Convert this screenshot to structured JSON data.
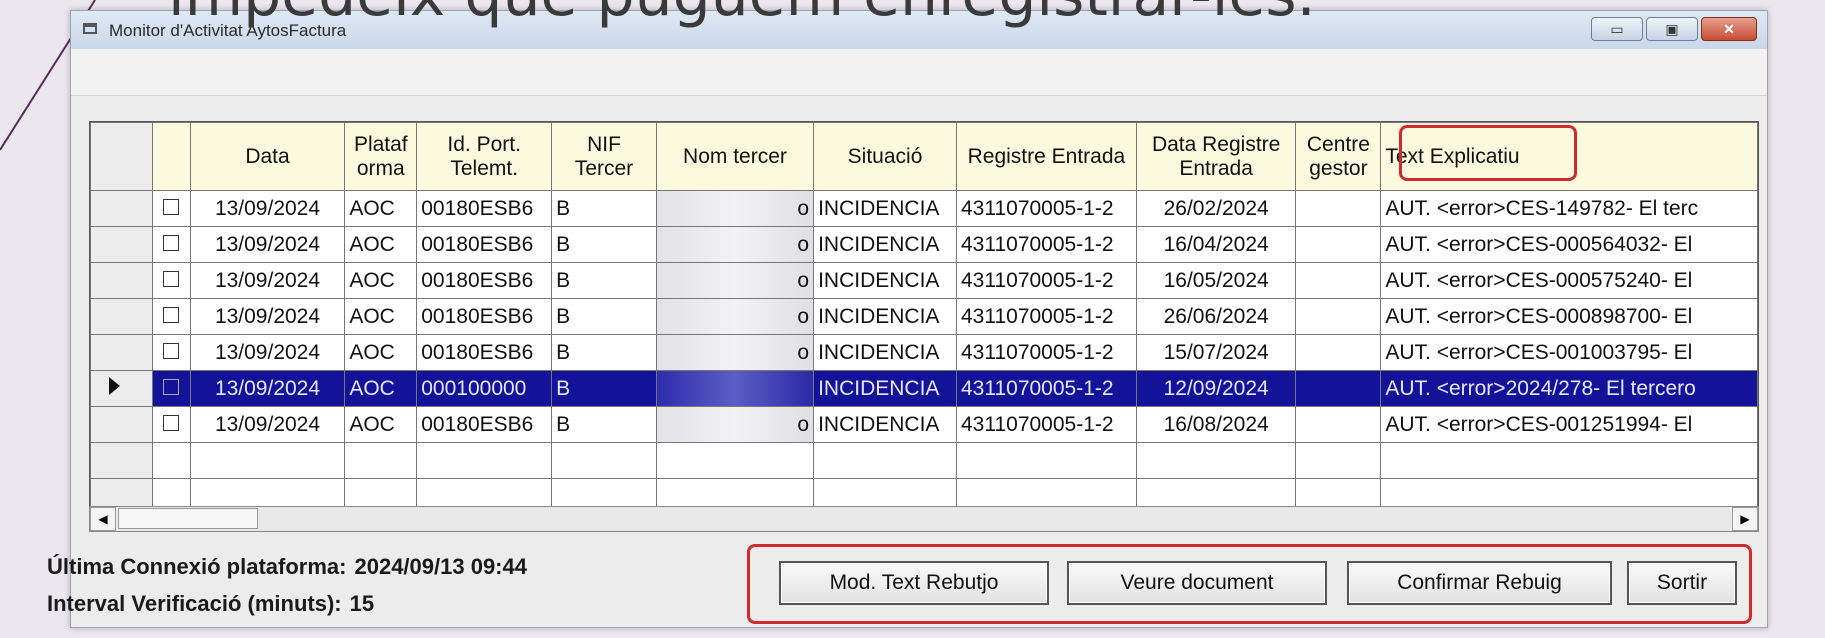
{
  "slide": {
    "caption": "impedeix que puguem enregistrar-les."
  },
  "window": {
    "title": "Monitor d'Activitat AytosFactura",
    "controls": {
      "minimize": "▭",
      "maximize": "▣",
      "close": "✕"
    }
  },
  "grid": {
    "columns": [
      "",
      "",
      "Data",
      "Plataf orma",
      "Id. Port. Telemt.",
      "NIF Tercer",
      "Nom tercer",
      "Situació",
      "Registre Entrada",
      "Data Registre Entrada",
      "Centre gestor",
      "Text Explicatiu"
    ],
    "rows": [
      {
        "data": "13/09/2024",
        "plataforma": "AOC",
        "id_port": "00180ESB6",
        "nif": "B",
        "nom": "o",
        "situacio": "INCIDENCIA",
        "registre": "4311070005-1-2",
        "data_registre": "26/02/2024",
        "centre": "",
        "text": "AUT. <error>CES-149782- El terc",
        "selected": false
      },
      {
        "data": "13/09/2024",
        "plataforma": "AOC",
        "id_port": "00180ESB6",
        "nif": "B",
        "nom": "o",
        "situacio": "INCIDENCIA",
        "registre": "4311070005-1-2",
        "data_registre": "16/04/2024",
        "centre": "",
        "text": "AUT. <error>CES-000564032- El",
        "selected": false
      },
      {
        "data": "13/09/2024",
        "plataforma": "AOC",
        "id_port": "00180ESB6",
        "nif": "B",
        "nom": "o",
        "situacio": "INCIDENCIA",
        "registre": "4311070005-1-2",
        "data_registre": "16/05/2024",
        "centre": "",
        "text": "AUT. <error>CES-000575240- El",
        "selected": false
      },
      {
        "data": "13/09/2024",
        "plataforma": "AOC",
        "id_port": "00180ESB6",
        "nif": "B",
        "nom": "o",
        "situacio": "INCIDENCIA",
        "registre": "4311070005-1-2",
        "data_registre": "26/06/2024",
        "centre": "",
        "text": "AUT. <error>CES-000898700- El",
        "selected": false
      },
      {
        "data": "13/09/2024",
        "plataforma": "AOC",
        "id_port": "00180ESB6",
        "nif": "B",
        "nom": "o",
        "situacio": "INCIDENCIA",
        "registre": "4311070005-1-2",
        "data_registre": "15/07/2024",
        "centre": "",
        "text": "AUT. <error>CES-001003795- El",
        "selected": false
      },
      {
        "data": "13/09/2024",
        "plataforma": "AOC",
        "id_port": "000100000",
        "nif": "B",
        "nom": "",
        "situacio": "INCIDENCIA",
        "registre": "4311070005-1-2",
        "data_registre": "12/09/2024",
        "centre": "",
        "text": "AUT. <error>2024/278- El tercero",
        "selected": true
      },
      {
        "data": "13/09/2024",
        "plataforma": "AOC",
        "id_port": "00180ESB6",
        "nif": "B",
        "nom": "o",
        "situacio": "INCIDENCIA",
        "registre": "4311070005-1-2",
        "data_registre": "16/08/2024",
        "centre": "",
        "text": "AUT. <error>CES-001251994- El",
        "selected": false
      }
    ],
    "scroll_left": "◀",
    "scroll_right": "▶"
  },
  "status": {
    "connection_label": "Última Connexió plataforma:",
    "connection_value": "2024/09/13 09:44",
    "interval_label": "Interval Verificació (minuts):",
    "interval_value": "15"
  },
  "buttons": {
    "mod_text": "Mod. Text Rebutjo",
    "veure": "Veure document",
    "confirmar": "Confirmar Rebuig",
    "sortir": "Sortir"
  },
  "colors": {
    "header_bg": "#fbfadf",
    "selected_row": "#13139a",
    "highlight": "#d22a2e"
  }
}
